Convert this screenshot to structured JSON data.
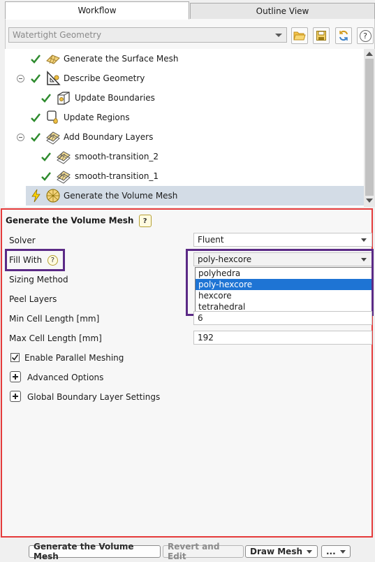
{
  "tabs": {
    "workflow": "Workflow",
    "outline": "Outline View"
  },
  "workflow_selector": {
    "value": "Watertight Geometry"
  },
  "toolbar_icons": [
    "open-folder-icon",
    "save-icon",
    "refresh-icon",
    "help-icon"
  ],
  "tree": {
    "items": [
      {
        "label": "Generate the Surface Mesh",
        "status": "done",
        "icon": "surface-mesh-icon"
      },
      {
        "label": "Describe Geometry",
        "status": "done",
        "icon": "describe-geometry-icon",
        "expanded": true
      },
      {
        "label": "Update Boundaries",
        "status": "done",
        "icon": "update-boundaries-icon"
      },
      {
        "label": "Update Regions",
        "status": "done",
        "icon": "update-regions-icon"
      },
      {
        "label": "Add Boundary Layers",
        "status": "done",
        "icon": "boundary-layers-icon",
        "expanded": true
      },
      {
        "label": "smooth-transition_2",
        "status": "done",
        "icon": "boundary-layers-icon"
      },
      {
        "label": "smooth-transition_1",
        "status": "done",
        "icon": "boundary-layers-icon"
      },
      {
        "label": "Generate the Volume Mesh",
        "status": "pending",
        "icon": "volume-mesh-icon",
        "selected": true
      }
    ]
  },
  "panel": {
    "title": "Generate the Volume Mesh",
    "help": "?",
    "solver_label": "Solver",
    "solver_value": "Fluent",
    "fill_with_label": "Fill With",
    "fill_with_value": "poly-hexcore",
    "fill_with_options": [
      "polyhedra",
      "poly-hexcore",
      "hexcore",
      "tetrahedral"
    ],
    "fill_with_selected_index": 1,
    "sizing_method_label": "Sizing Method",
    "peel_layers_label": "Peel Layers",
    "min_cell_label": "Min Cell Length [mm]",
    "min_cell_value": "6",
    "max_cell_label": "Max Cell Length [mm]",
    "max_cell_value": "192",
    "parallel_label": "Enable Parallel Meshing",
    "parallel_checked": true,
    "advanced_label": "Advanced Options",
    "global_bl_label": "Global Boundary Layer Settings"
  },
  "buttons": {
    "generate": "Generate the Volume Mesh",
    "revert": "Revert and Edit",
    "draw": "Draw Mesh",
    "more": "..."
  },
  "colors": {
    "panel_border": "#e53b3b",
    "highlight_box": "#5b2a86",
    "check_green": "#2e8b2e",
    "selection_blue": "#1e74d4"
  }
}
